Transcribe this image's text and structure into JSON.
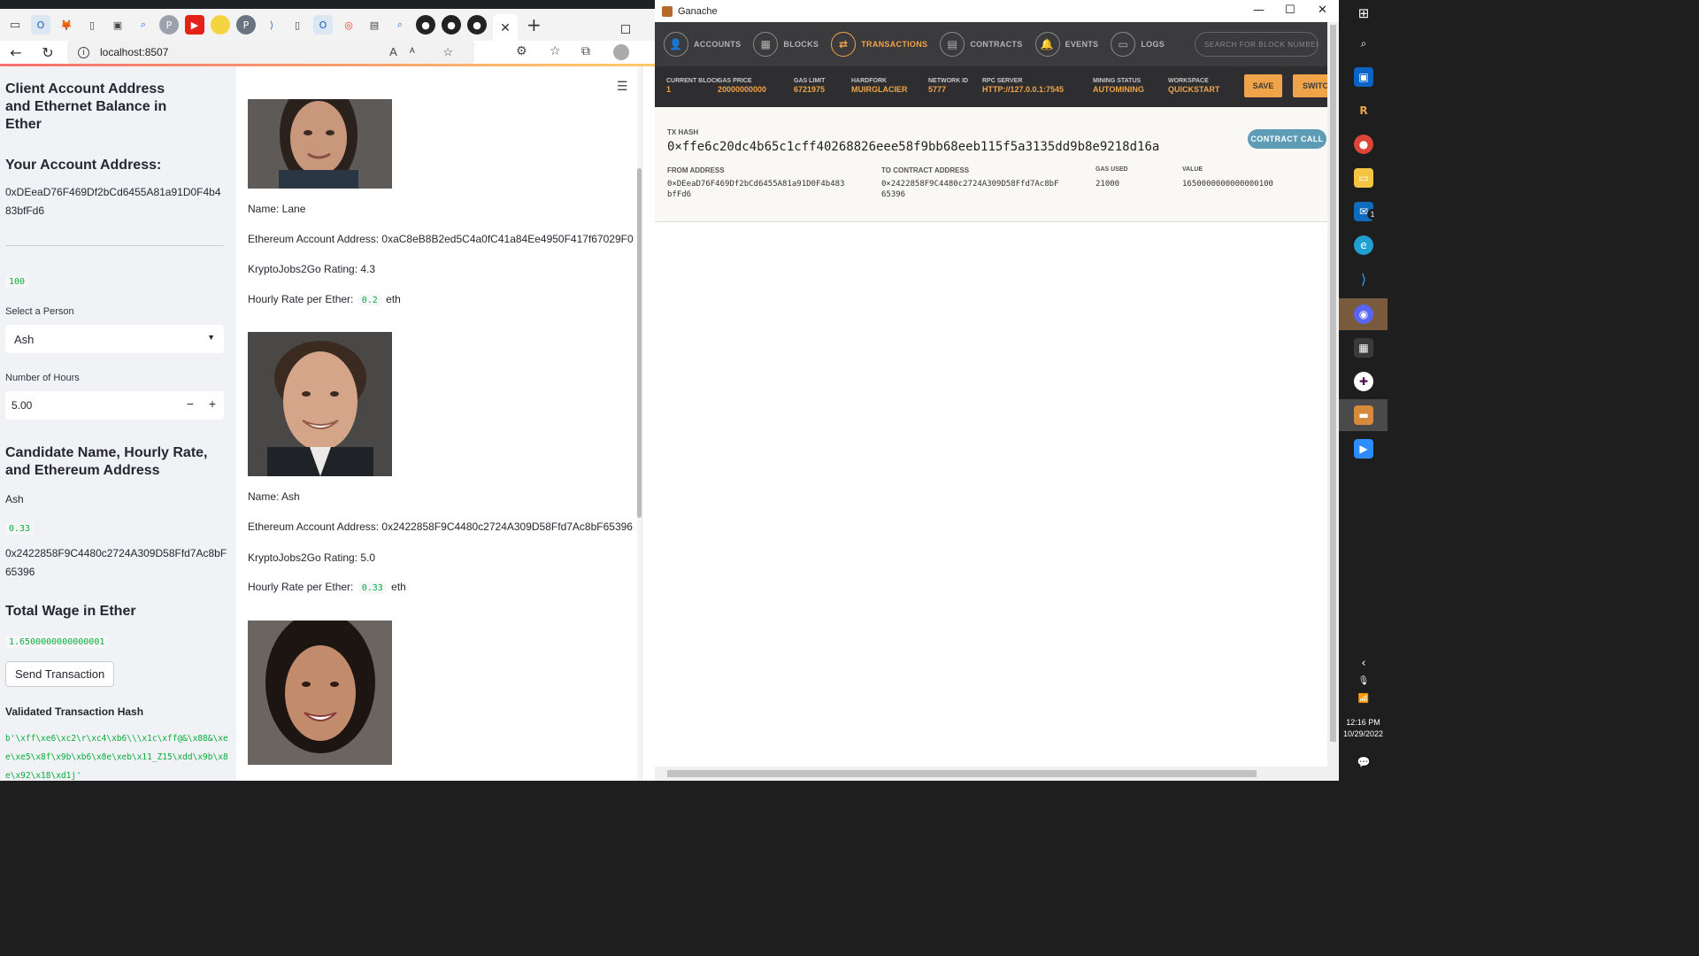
{
  "browser": {
    "url": "localhost:8507",
    "tab_icons": [
      "outlook-icon",
      "metamask-icon",
      "page-icon",
      "video-icon",
      "search-icon",
      "profile-icon",
      "youtube-icon",
      "circle-icon",
      "github-dark-icon",
      "vscode-icon",
      "page-icon",
      "zoom-icon",
      "ring-icon",
      "photo-icon",
      "search-icon",
      "github-icon",
      "github-icon",
      "github-icon"
    ]
  },
  "sidebar": {
    "heading": "Client Account Address and Ethernet Balance in Ether",
    "account_heading": "Your Account Address:",
    "account_address": "0xDEeaD76F469Df2bCd6455A81a91D0F4b483bfFd6",
    "balance": "100",
    "select_label": "Select a Person",
    "select_value": "Ash",
    "hours_label": "Number of Hours",
    "hours_value": "5.00",
    "hours_minus": "−",
    "hours_plus": "+",
    "candidate_heading": "Candidate Name, Hourly Rate, and Ethereum Address",
    "candidate_name": "Ash",
    "candidate_rate": "0.33",
    "candidate_address": "0x2422858F9C4480c2724A309D58Ffd7Ac8bF65396",
    "total_heading": "Total Wage in Ether",
    "total_wage": "1.6500000000000001",
    "send_button": "Send Transaction",
    "hash_heading": "Validated Transaction Hash",
    "hash_value": "b'\\xff\\xe6\\xc2\\r\\xc4\\xb6\\\\\\x1c\\xff@&\\x88&\\xee\\xe5\\x8f\\x9b\\xb6\\x8e\\xeb\\x11_Z15\\xdd\\x9b\\x8e\\x92\\x18\\xd1j'"
  },
  "candidates": [
    {
      "name": "Name: Lane",
      "address": "Ethereum Account Address: 0xaC8eB8B2ed5C4a0fC41a84Ee4950F417f67029F0",
      "rating": "KryptoJobs2Go Rating: 4.3",
      "rate_label": "Hourly Rate per Ether:",
      "rate": "0.2",
      "unit": "eth"
    },
    {
      "name": "Name: Ash",
      "address": "Ethereum Account Address: 0x2422858F9C4480c2724A309D58Ffd7Ac8bF65396",
      "rating": "KryptoJobs2Go Rating: 5.0",
      "rate_label": "Hourly Rate per Ether:",
      "rate": "0.33",
      "unit": "eth"
    }
  ],
  "ganache": {
    "title": "Ganache",
    "nav": [
      "ACCOUNTS",
      "BLOCKS",
      "TRANSACTIONS",
      "CONTRACTS",
      "EVENTS",
      "LOGS"
    ],
    "search_placeholder": "SEARCH FOR BLOCK NUMBERS OR TX HASHES",
    "status": {
      "current_block_label": "CURRENT BLOCK",
      "current_block": "1",
      "gas_price_label": "GAS PRICE",
      "gas_price": "20000000000",
      "gas_limit_label": "GAS LIMIT",
      "gas_limit": "6721975",
      "hardfork_label": "HARDFORK",
      "hardfork": "MUIRGLACIER",
      "network_id_label": "NETWORK ID",
      "network_id": "5777",
      "rpc_label": "RPC SERVER",
      "rpc": "HTTP://127.0.0.1:7545",
      "mining_label": "MINING STATUS",
      "mining": "AUTOMINING",
      "workspace_label": "WORKSPACE",
      "workspace": "QUICKSTART"
    },
    "save_button": "SAVE",
    "switch_button": "SWITCH",
    "tx": {
      "hash_label": "TX HASH",
      "hash": "0×ffe6c20dc4b65c1cff40268826eee58f9bb68eeb115f5a3135dd9b8e9218d16a",
      "badge": "CONTRACT CALL",
      "from_label": "FROM ADDRESS",
      "from_line1": "0×DEeaD76F469Df2bCd6455A81a91D0F4b483",
      "from_line2": "bfFd6",
      "to_label": "TO CONTRACT ADDRESS",
      "to_line1": "0×2422858F9C4480c2724A309D58Ffd7Ac8bF",
      "to_line2": "65396",
      "gas_used_label": "GAS USED",
      "gas_used": "21000",
      "value_label": "VALUE",
      "value": "1650000000000000100"
    }
  },
  "taskbar": {
    "time": "12:16 PM",
    "date": "10/29/2022",
    "mail_badge": "1"
  }
}
